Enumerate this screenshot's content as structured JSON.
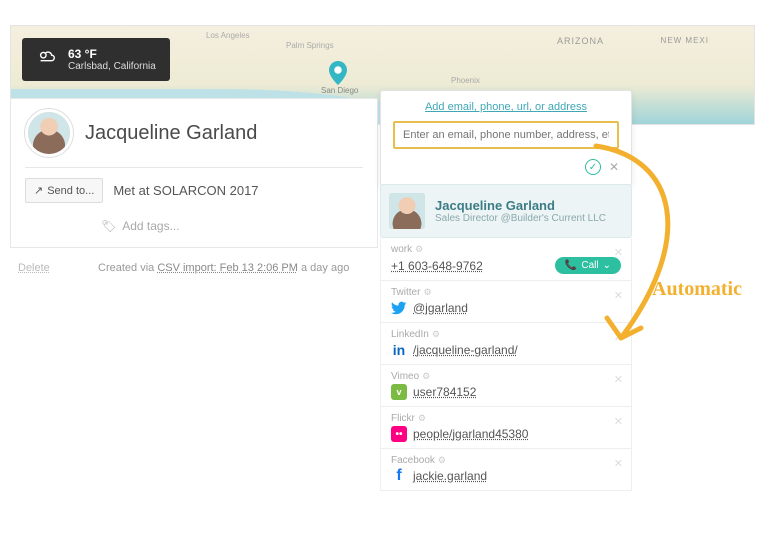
{
  "map": {
    "labels": {
      "arizona": "ARIZONA",
      "newmexico": "NEW MEXI",
      "losangeles": "Los Angeles",
      "palmsprings": "Palm Springs",
      "sandiego": "San Diego",
      "phoenix": "Phoenix"
    }
  },
  "weather": {
    "temp": "63 °F",
    "location": "Carlsbad, California"
  },
  "contact": {
    "name": "Jacqueline Garland",
    "subtitle": "Met at SOLARCON 2017",
    "send_to_label": "Send to...",
    "add_tags_label": "Add tags...",
    "delete_label": "Delete",
    "created_prefix": "Created via ",
    "created_link": "CSV import: Feb 13 2:06 PM",
    "created_suffix": " a day ago"
  },
  "popup": {
    "add_link_label": "Add email, phone, url, or address",
    "input_placeholder": "Enter an email, phone number, address, etc.",
    "profile": {
      "name": "Jacqueline Garland",
      "title": "Sales Director @Builder's Current LLC"
    },
    "details": [
      {
        "key": "work",
        "label": "work",
        "value": "+1 603-648-9762",
        "call": "Call",
        "icon": "phone"
      },
      {
        "key": "twitter",
        "label": "Twitter",
        "value": "@jgarland",
        "icon": "tw"
      },
      {
        "key": "linkedin",
        "label": "LinkedIn",
        "value": "/jacqueline-garland/",
        "icon": "li"
      },
      {
        "key": "vimeo",
        "label": "Vimeo",
        "value": "user784152",
        "icon": "vm"
      },
      {
        "key": "flickr",
        "label": "Flickr",
        "value": "people/jgarland45380",
        "icon": "fl"
      },
      {
        "key": "facebook",
        "label": "Facebook",
        "value": "jackie.garland",
        "icon": "fb"
      }
    ]
  },
  "annotation": {
    "text": "Automatic"
  }
}
